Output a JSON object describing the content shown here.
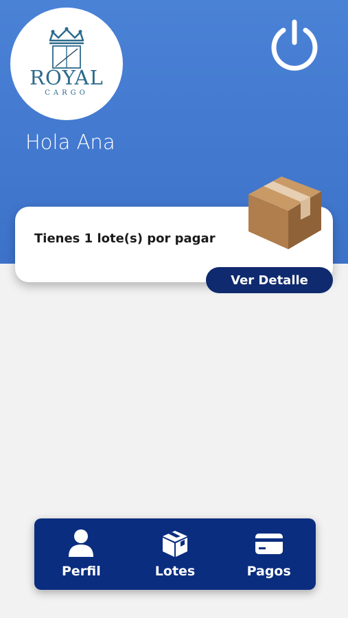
{
  "header": {
    "logo_text": "ROYAL",
    "logo_subtext": "CARGO",
    "greeting": "Hola Ana",
    "power_icon": "power-icon"
  },
  "card": {
    "message": "Tienes 1 lote(s) por pagar",
    "icon": "package-box-icon",
    "button_label": "Ver Detalle"
  },
  "nav": {
    "items": [
      {
        "label": "Perfil",
        "icon": "user-icon"
      },
      {
        "label": "Lotes",
        "icon": "box-icon"
      },
      {
        "label": "Pagos",
        "icon": "credit-card-icon"
      }
    ]
  },
  "colors": {
    "header_blue": "#4a82d6",
    "nav_navy": "#0a2d7f",
    "button_navy": "#0f2a6e",
    "background": "#f2f2f2"
  }
}
